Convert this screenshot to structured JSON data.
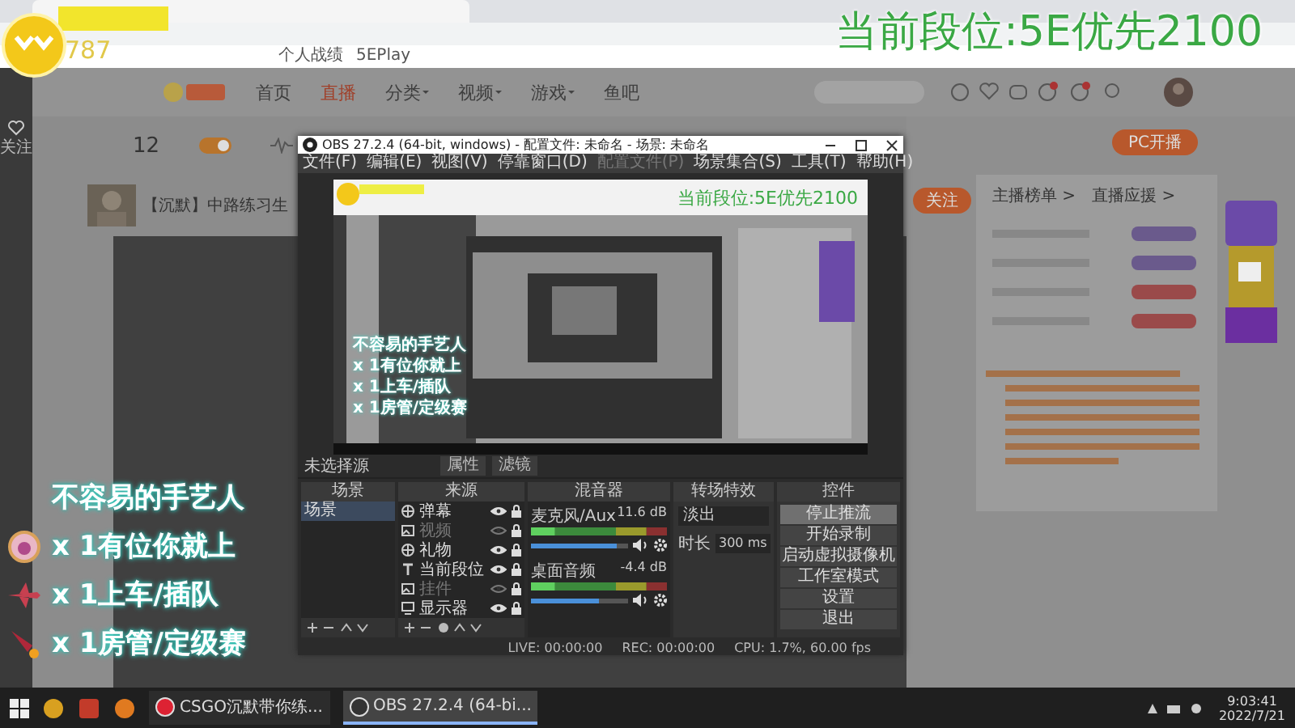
{
  "browser": {
    "bookmarks": [
      "个人战绩",
      "5EPlay"
    ]
  },
  "overlay": {
    "rank_text": "当前段位:5E优先2100",
    "viewer_count": "787",
    "gifts_title": "不容易的手艺人",
    "gifts": [
      {
        "kind": "medal",
        "text": "x 1有位你就上"
      },
      {
        "kind": "plane",
        "text": "x 1上车/插队"
      },
      {
        "kind": "rocket",
        "text": "x 1房管/定级赛"
      }
    ]
  },
  "site": {
    "nav": [
      {
        "label": "首页",
        "selected": false,
        "caret": false
      },
      {
        "label": "直播",
        "selected": true,
        "caret": false
      },
      {
        "label": "分类",
        "selected": false,
        "caret": true
      },
      {
        "label": "视频",
        "selected": false,
        "caret": true
      },
      {
        "label": "游戏",
        "selected": false,
        "caret": true
      },
      {
        "label": "鱼吧",
        "selected": false,
        "caret": false
      }
    ],
    "sidebar_label": "关注",
    "stat": "12",
    "room_title": "【沉默】中路练习生",
    "follow": "关注",
    "pc_live": "PC开播",
    "rank_links": [
      "主播榜单 >",
      "直播应援 >"
    ]
  },
  "obs": {
    "title": "OBS 27.2.4 (64-bit, windows) - 配置文件: 未命名 - 场景: 未命名",
    "menu": [
      {
        "label": "文件(F)",
        "disabled": false
      },
      {
        "label": "编辑(E)",
        "disabled": false
      },
      {
        "label": "视图(V)",
        "disabled": false
      },
      {
        "label": "停靠窗口(D)",
        "disabled": false
      },
      {
        "label": "配置文件(P)",
        "disabled": true
      },
      {
        "label": "场景集合(S)",
        "disabled": false
      },
      {
        "label": "工具(T)",
        "disabled": false
      },
      {
        "label": "帮助(H)",
        "disabled": false
      }
    ],
    "preview": {
      "rank_text": "当前段位:5E优先2100",
      "gifts_title": "不容易的手艺人",
      "gifts": [
        "x 1有位你就上",
        "x 1上车/插队",
        "x 1房管/定级赛"
      ]
    },
    "source_bar": {
      "label": "未选择源",
      "buttons": [
        "属性",
        "滤镜"
      ]
    },
    "docks": [
      "场景",
      "来源",
      "混音器",
      "转场特效",
      "控件"
    ],
    "scenes": [
      {
        "label": "场景",
        "selected": true
      }
    ],
    "sources": [
      {
        "kind": "browser",
        "label": "弹幕",
        "visible": true
      },
      {
        "kind": "image",
        "label": "视频",
        "visible": false
      },
      {
        "kind": "browser",
        "label": "礼物",
        "visible": true
      },
      {
        "kind": "text",
        "label": "当前段位",
        "visible": true
      },
      {
        "kind": "image",
        "label": "挂件",
        "visible": false
      },
      {
        "kind": "display",
        "label": "显示器",
        "visible": true
      }
    ],
    "mixer": [
      {
        "name": "麦克风/Aux",
        "reading": "11.6 dB",
        "level": 0.88
      },
      {
        "name": "桌面音频",
        "reading": "-4.4 dB",
        "level": 0.7
      }
    ],
    "transition": {
      "type": "淡出",
      "duration_label": "时长",
      "duration": "300 ms"
    },
    "controls": [
      {
        "label": "停止推流",
        "highlighted": true
      },
      {
        "label": "开始录制",
        "highlighted": false
      },
      {
        "label": "启动虚拟摄像机",
        "highlighted": false
      },
      {
        "label": "工作室模式",
        "highlighted": false
      },
      {
        "label": "设置",
        "highlighted": false
      },
      {
        "label": "退出",
        "highlighted": false
      }
    ],
    "status": {
      "live": "LIVE: 00:00:00",
      "rec": "REC: 00:00:00",
      "cpu": "CPU: 1.7%, 60.00 fps"
    }
  },
  "taskbar": {
    "tasks": [
      {
        "label": "CSGO沉默带你练...",
        "active": false
      },
      {
        "label": "OBS 27.2.4 (64-bi...",
        "active": true
      }
    ],
    "time": "9:03:41",
    "date": "2022/7/21"
  }
}
